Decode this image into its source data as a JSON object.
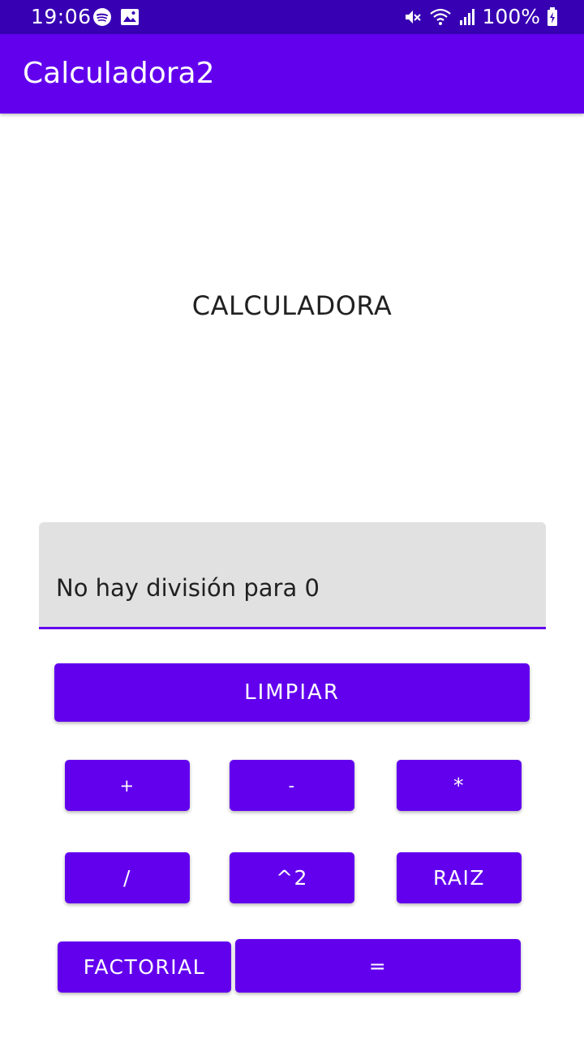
{
  "status_bar": {
    "time": "19:06",
    "battery": "100%",
    "icons": [
      "spotify-icon",
      "image-icon",
      "mute-icon",
      "wifi-icon",
      "signal-icon",
      "battery-charging-icon"
    ]
  },
  "app_bar": {
    "title": "Calculadora2"
  },
  "main": {
    "heading": "CALCULADORA",
    "result_value": "No hay división para 0"
  },
  "buttons": {
    "clear": "LIMPIAR",
    "add": "+",
    "subtract": "-",
    "multiply": "*",
    "divide": "/",
    "square": "^2",
    "root": "RAIZ",
    "factorial": "FACTORIAL",
    "equals": "="
  },
  "colors": {
    "status_bar": "#3700b3",
    "primary": "#6200ee",
    "field_background": "#e1e1e1"
  }
}
